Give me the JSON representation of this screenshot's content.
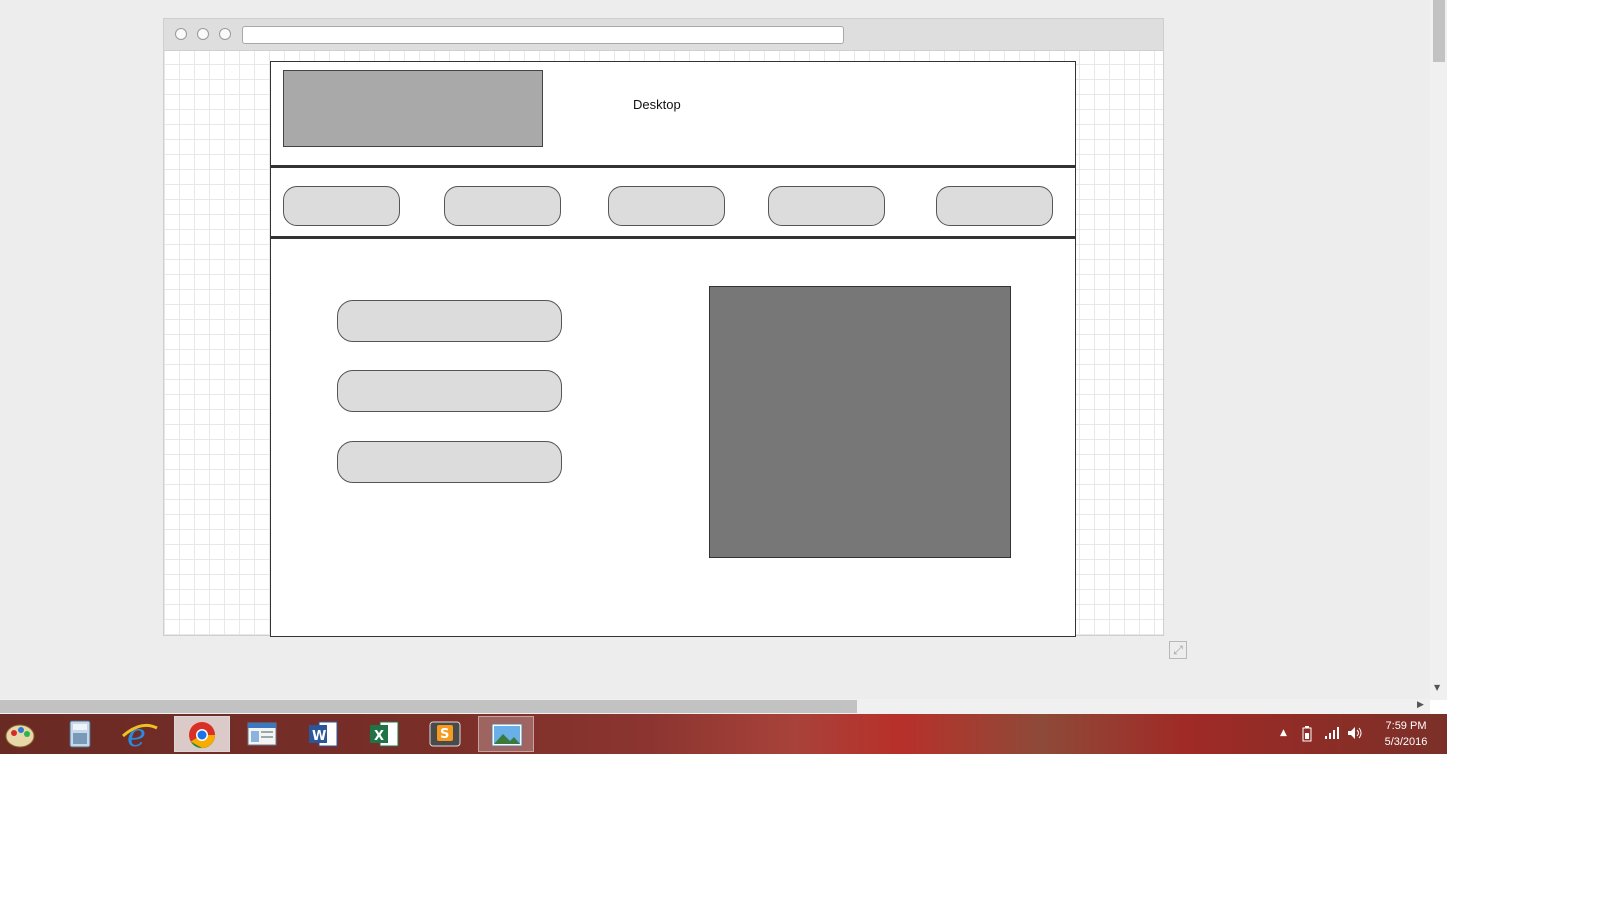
{
  "wireframe": {
    "page_title": "Desktop",
    "nav_buttons": [
      "",
      "",
      "",
      "",
      ""
    ],
    "side_buttons": [
      "",
      "",
      ""
    ]
  },
  "taskbar": {
    "apps": [
      "paint-icon",
      "calculator-icon",
      "internet-explorer-icon",
      "chrome-icon",
      "file-explorer-icon",
      "word-icon",
      "excel-icon",
      "sublime-text-icon",
      "photo-viewer-icon"
    ],
    "active_app": "chrome-icon",
    "clock_time": "7:59 PM",
    "clock_date": "5/3/2016"
  },
  "colors": {
    "logo_placeholder": "#a9a9a9",
    "image_placeholder": "#777777",
    "button_fill": "#dcdcdc",
    "taskbar": "#8c3530"
  }
}
